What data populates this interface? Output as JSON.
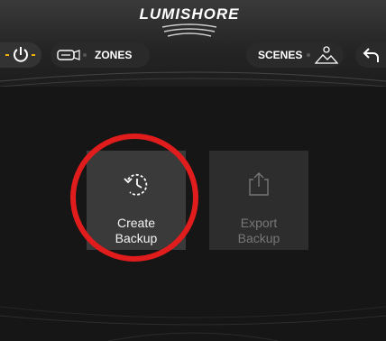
{
  "header": {
    "brand": "LUMISHORE",
    "zones_label": "ZONES",
    "scenes_label": "SCENES"
  },
  "icons": {
    "power": "power-icon",
    "zones": "light-fixture-icon",
    "scenes": "mountain-sun-icon",
    "back": "back-arrow-icon",
    "create_backup": "restore-clock-icon",
    "export_backup": "share-export-icon"
  },
  "tiles": [
    {
      "line1": "Create",
      "line2": "Backup",
      "enabled": true
    },
    {
      "line1": "Export",
      "line2": "Backup",
      "enabled": false
    }
  ],
  "colors": {
    "accent_power": "#f0b400",
    "highlight": "#e11c1c",
    "background": "#161616"
  }
}
